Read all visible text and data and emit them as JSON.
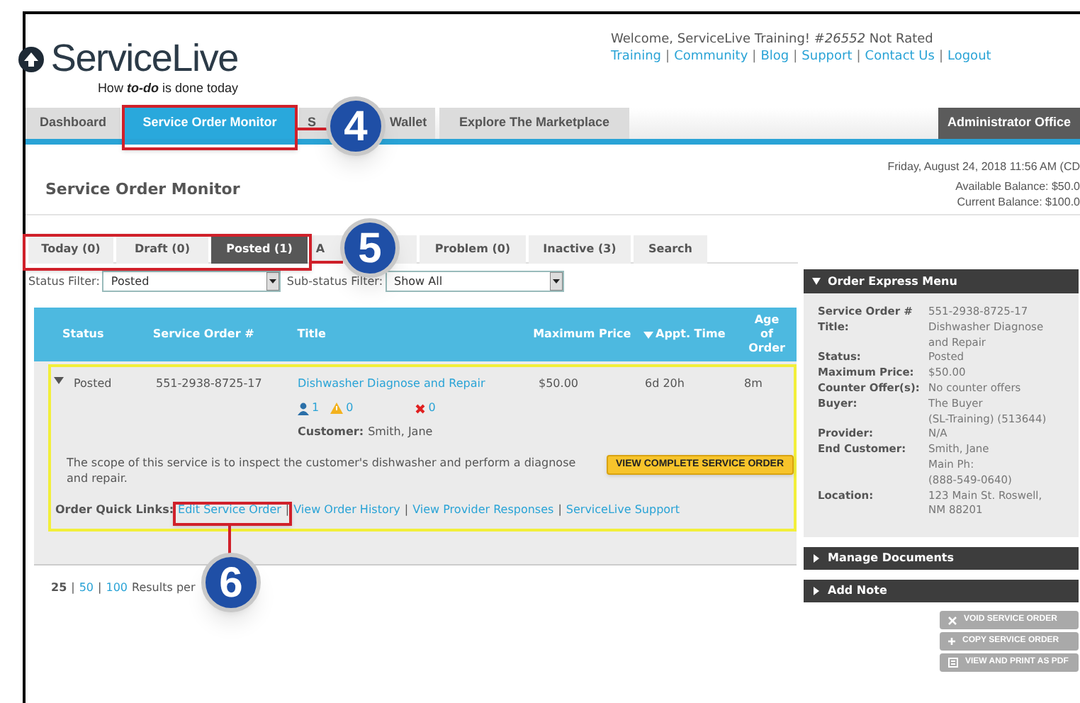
{
  "header": {
    "logo": {
      "name": "ServiceLive",
      "tagline_parts": [
        "How ",
        "to-do",
        " is done today"
      ]
    },
    "welcome": "Welcome, ServiceLive Training! *#26552* Not Rated",
    "links": [
      "Training",
      "Community",
      "Blog",
      "Support",
      "Contact Us",
      "Logout"
    ],
    "separator": "|"
  },
  "nav_tabs": [
    {
      "kind": "plain",
      "label": "Dashboard",
      "selected": false
    },
    {
      "kind": "plain",
      "label": "Service Order Monitor",
      "selected": true
    },
    {
      "kind": "split",
      "label_start": "S",
      "label_end": "Wallet",
      "selected": false
    },
    {
      "kind": "plain",
      "label": "Explore The Marketplace",
      "selected": false
    }
  ],
  "admin_tab": "Administrator Office",
  "page_title": "Service Order Monitor",
  "date": "Friday, August 24, 2018 11:56 AM (CD",
  "balances": [
    "Available Balance: $50.0",
    "Current Balance: $100.0"
  ],
  "status_tabs": [
    {
      "label": "Today (0)",
      "selected": false
    },
    {
      "label": "Draft (0)",
      "selected": false
    },
    {
      "label": "Posted (1)",
      "selected": true
    },
    {
      "label": "A",
      "selected": false
    },
    {
      "label": "Problem (0)",
      "selected": false
    },
    {
      "label": "Inactive (3)",
      "selected": false
    },
    {
      "label": "Search",
      "selected": false
    }
  ],
  "filters": [
    {
      "label": "Status Filter:",
      "value": "Posted"
    },
    {
      "label": "Sub-status Filter:",
      "value": "Show All"
    }
  ],
  "table": {
    "columns": [
      "Status",
      "Service Order #",
      "Title",
      "Maximum Price",
      "Appt. Time",
      "Age of Order"
    ],
    "row": {
      "expanded": true,
      "status": "Posted",
      "order_no": "551-2938-8725-17",
      "title": "Dishwasher Diagnose and Repair",
      "price": "$50.00",
      "appt": "6d 20h",
      "age": "8m",
      "counts": [
        {
          "kind": "person",
          "value": "1"
        },
        {
          "kind": "warning",
          "value": "0"
        },
        {
          "kind": "reject",
          "value": "0"
        }
      ],
      "customer_label": "Customer:",
      "customer": "Smith, Jane",
      "description": "The scope of this service is to inspect the customer's dishwasher and perform a diagnose and repair.",
      "view_button": "VIEW COMPLETE SERVICE ORDER",
      "quick_links_label": "Order Quick Links:",
      "quick_links": [
        "Edit Service Order",
        "View Order History",
        "View Provider Responses",
        "ServiceLive Support"
      ],
      "separator": "|"
    }
  },
  "pager": {
    "options": [
      {
        "label": "25",
        "selected": true
      },
      {
        "label": "50",
        "selected": false
      },
      {
        "label": "100",
        "selected": false
      }
    ],
    "separator": "|",
    "suffix": "Results per"
  },
  "express_menu": {
    "title": "Order Express Menu",
    "fields": [
      {
        "label": "Service Order #",
        "value": [
          "551-2938-8725-17"
        ]
      },
      {
        "label": "Title:",
        "value": [
          "Dishwasher Diagnose",
          "and Repair"
        ]
      },
      {
        "label": "Status:",
        "value": [
          "Posted"
        ]
      },
      {
        "label": "Maximum Price:",
        "value": [
          "$50.00"
        ]
      },
      {
        "label": "Counter Offer(s):",
        "value": [
          "No counter offers"
        ]
      },
      {
        "label": "Buyer:",
        "value": [
          "The Buyer",
          "(SL-Training) (513644)"
        ]
      },
      {
        "label": "Provider:",
        "value": [
          "N/A"
        ]
      },
      {
        "label": "End Customer:",
        "value": [
          "Smith, Jane",
          "Main Ph:",
          "(888-549-0640)"
        ]
      },
      {
        "label": "Location:",
        "value": [
          "123 Main St. Roswell,",
          "NM 88201"
        ]
      }
    ]
  },
  "collapsed_panels": [
    {
      "title": "Manage Documents",
      "expanded": false
    },
    {
      "title": "Add Note",
      "expanded": false
    }
  ],
  "action_buttons": [
    {
      "kind": "void",
      "label": "VOID SERVICE ORDER"
    },
    {
      "kind": "copy",
      "label": "COPY SERVICE ORDER"
    },
    {
      "kind": "print",
      "label": "VIEW AND PRINT AS PDF"
    }
  ],
  "callouts": [
    "4",
    "5",
    "6"
  ]
}
